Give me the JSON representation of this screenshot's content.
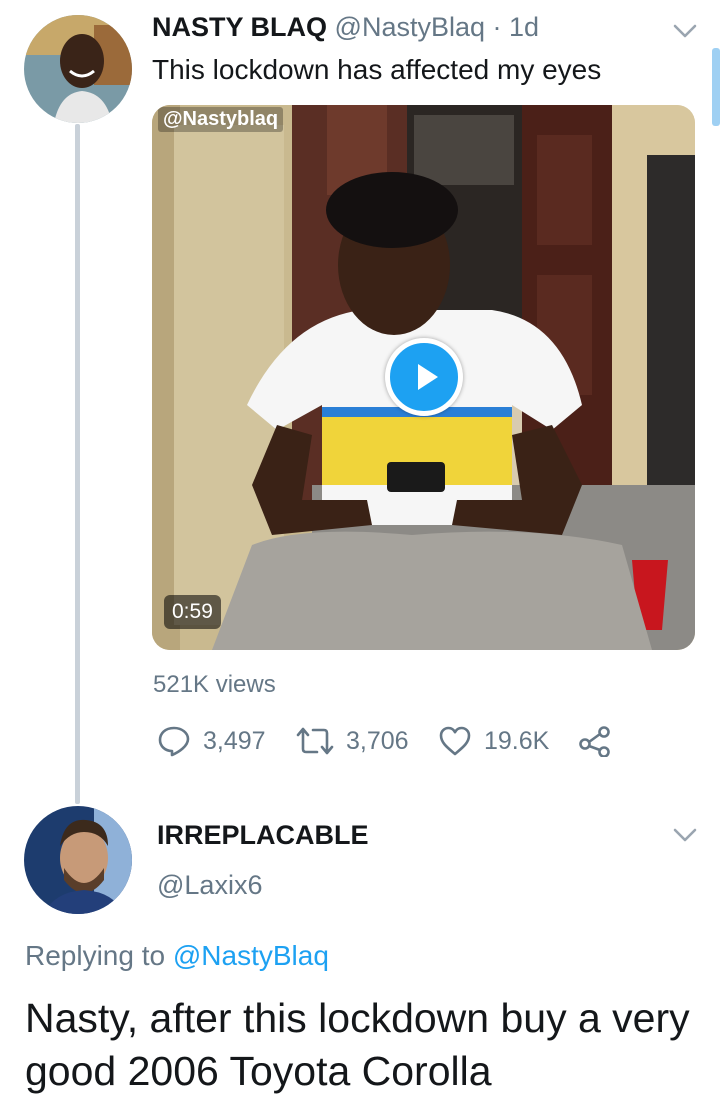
{
  "tweet1": {
    "name": "NASTY BLAQ",
    "handle": "@NastyBlaq",
    "separator": " · ",
    "time": "1d",
    "text": "This lockdown has affected my eyes",
    "media": {
      "watermark": "@Nastyblaq",
      "duration": "0:59",
      "play_icon": "play-icon"
    },
    "views": "521K views",
    "actions": {
      "replies": "3,497",
      "retweets": "3,706",
      "likes": "19.6K",
      "reply_icon": "reply-icon",
      "retweet_icon": "retweet-icon",
      "like_icon": "heart-icon",
      "share_icon": "share-icon"
    }
  },
  "tweet2": {
    "name": "IRREPLACABLE",
    "handle": "@Laxix6",
    "replying_prefix": "Replying to ",
    "replying_to": "@NastyBlaq",
    "text": "Nasty, after this lockdown buy a very good 2006 Toyota Corolla"
  },
  "colors": {
    "accent": "#1da1f2",
    "secondary_text": "#657786",
    "primary_text": "#14171a"
  }
}
